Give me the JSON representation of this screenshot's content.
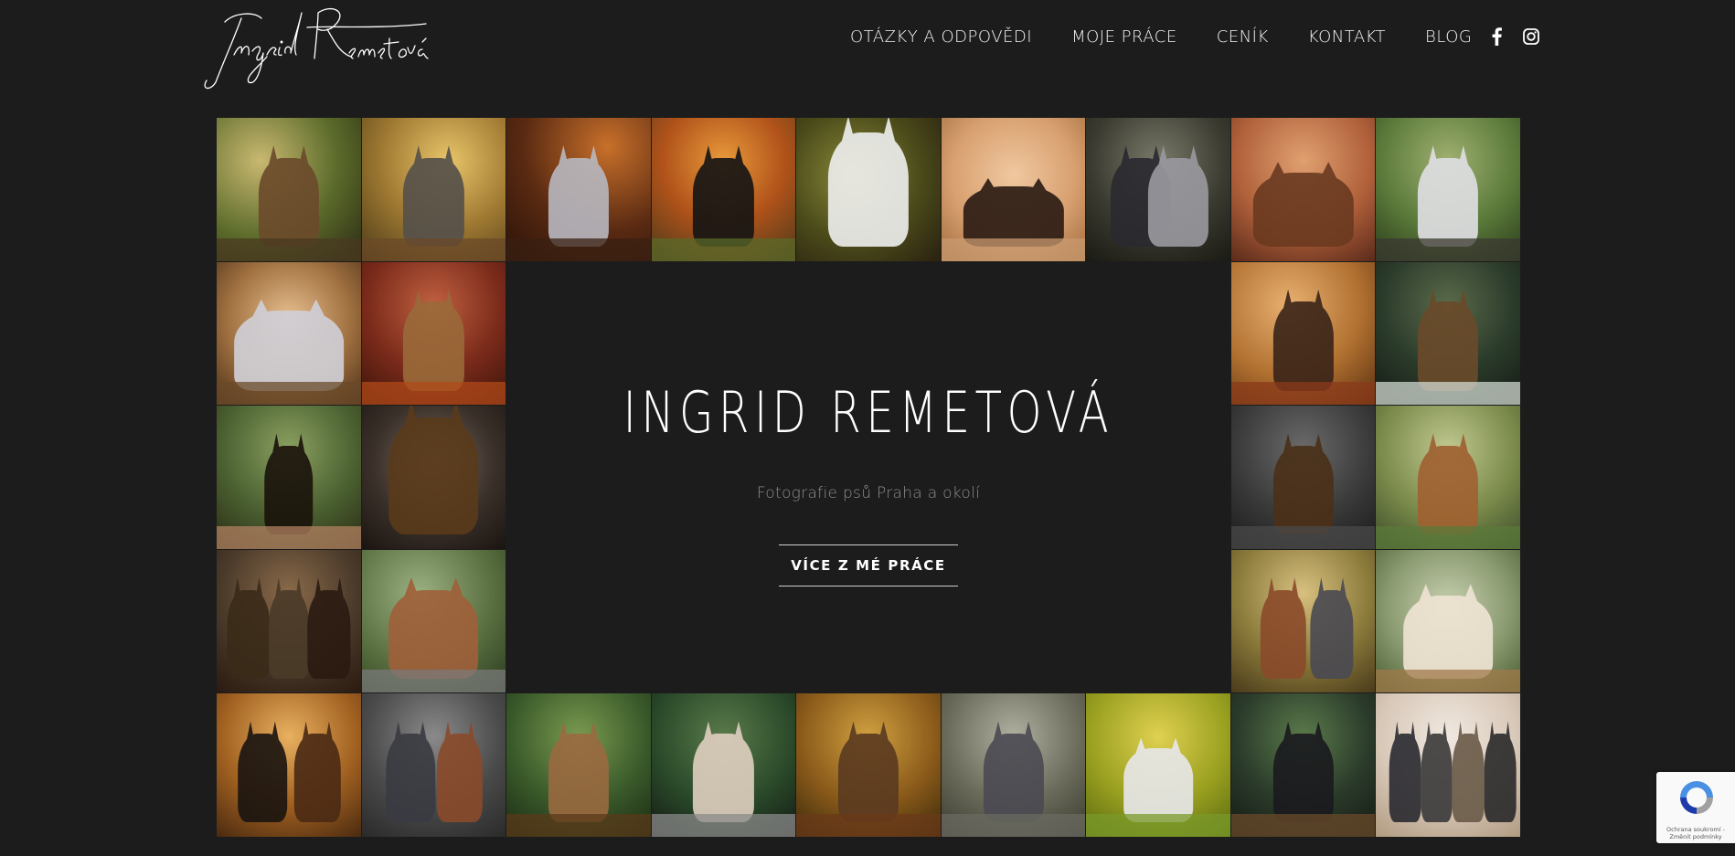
{
  "header": {
    "logo_text": "Ingrid Remetová",
    "nav": [
      {
        "label": "OTÁZKY A ODPOVĚDI"
      },
      {
        "label": "MOJE PRÁCE"
      },
      {
        "label": "CENÍK"
      },
      {
        "label": "KONTAKT"
      },
      {
        "label": "BLOG"
      }
    ],
    "social": [
      {
        "icon": "facebook-icon"
      },
      {
        "icon": "instagram-icon"
      }
    ]
  },
  "hero": {
    "title": "INGRID REMETOVÁ",
    "subtitle": "Fotografie psů Praha a okolí",
    "button_label": "VÍCE Z MÉ PRÁCE"
  },
  "gallery": {
    "photo_count": 30,
    "subject": "dog photographs"
  },
  "recaptcha": {
    "text": "Ochrana soukromí - Změnit podmínky"
  },
  "colors": {
    "background": "#1d1c1c",
    "text": "#ffffff",
    "subtitle": "#8d8d8d"
  }
}
